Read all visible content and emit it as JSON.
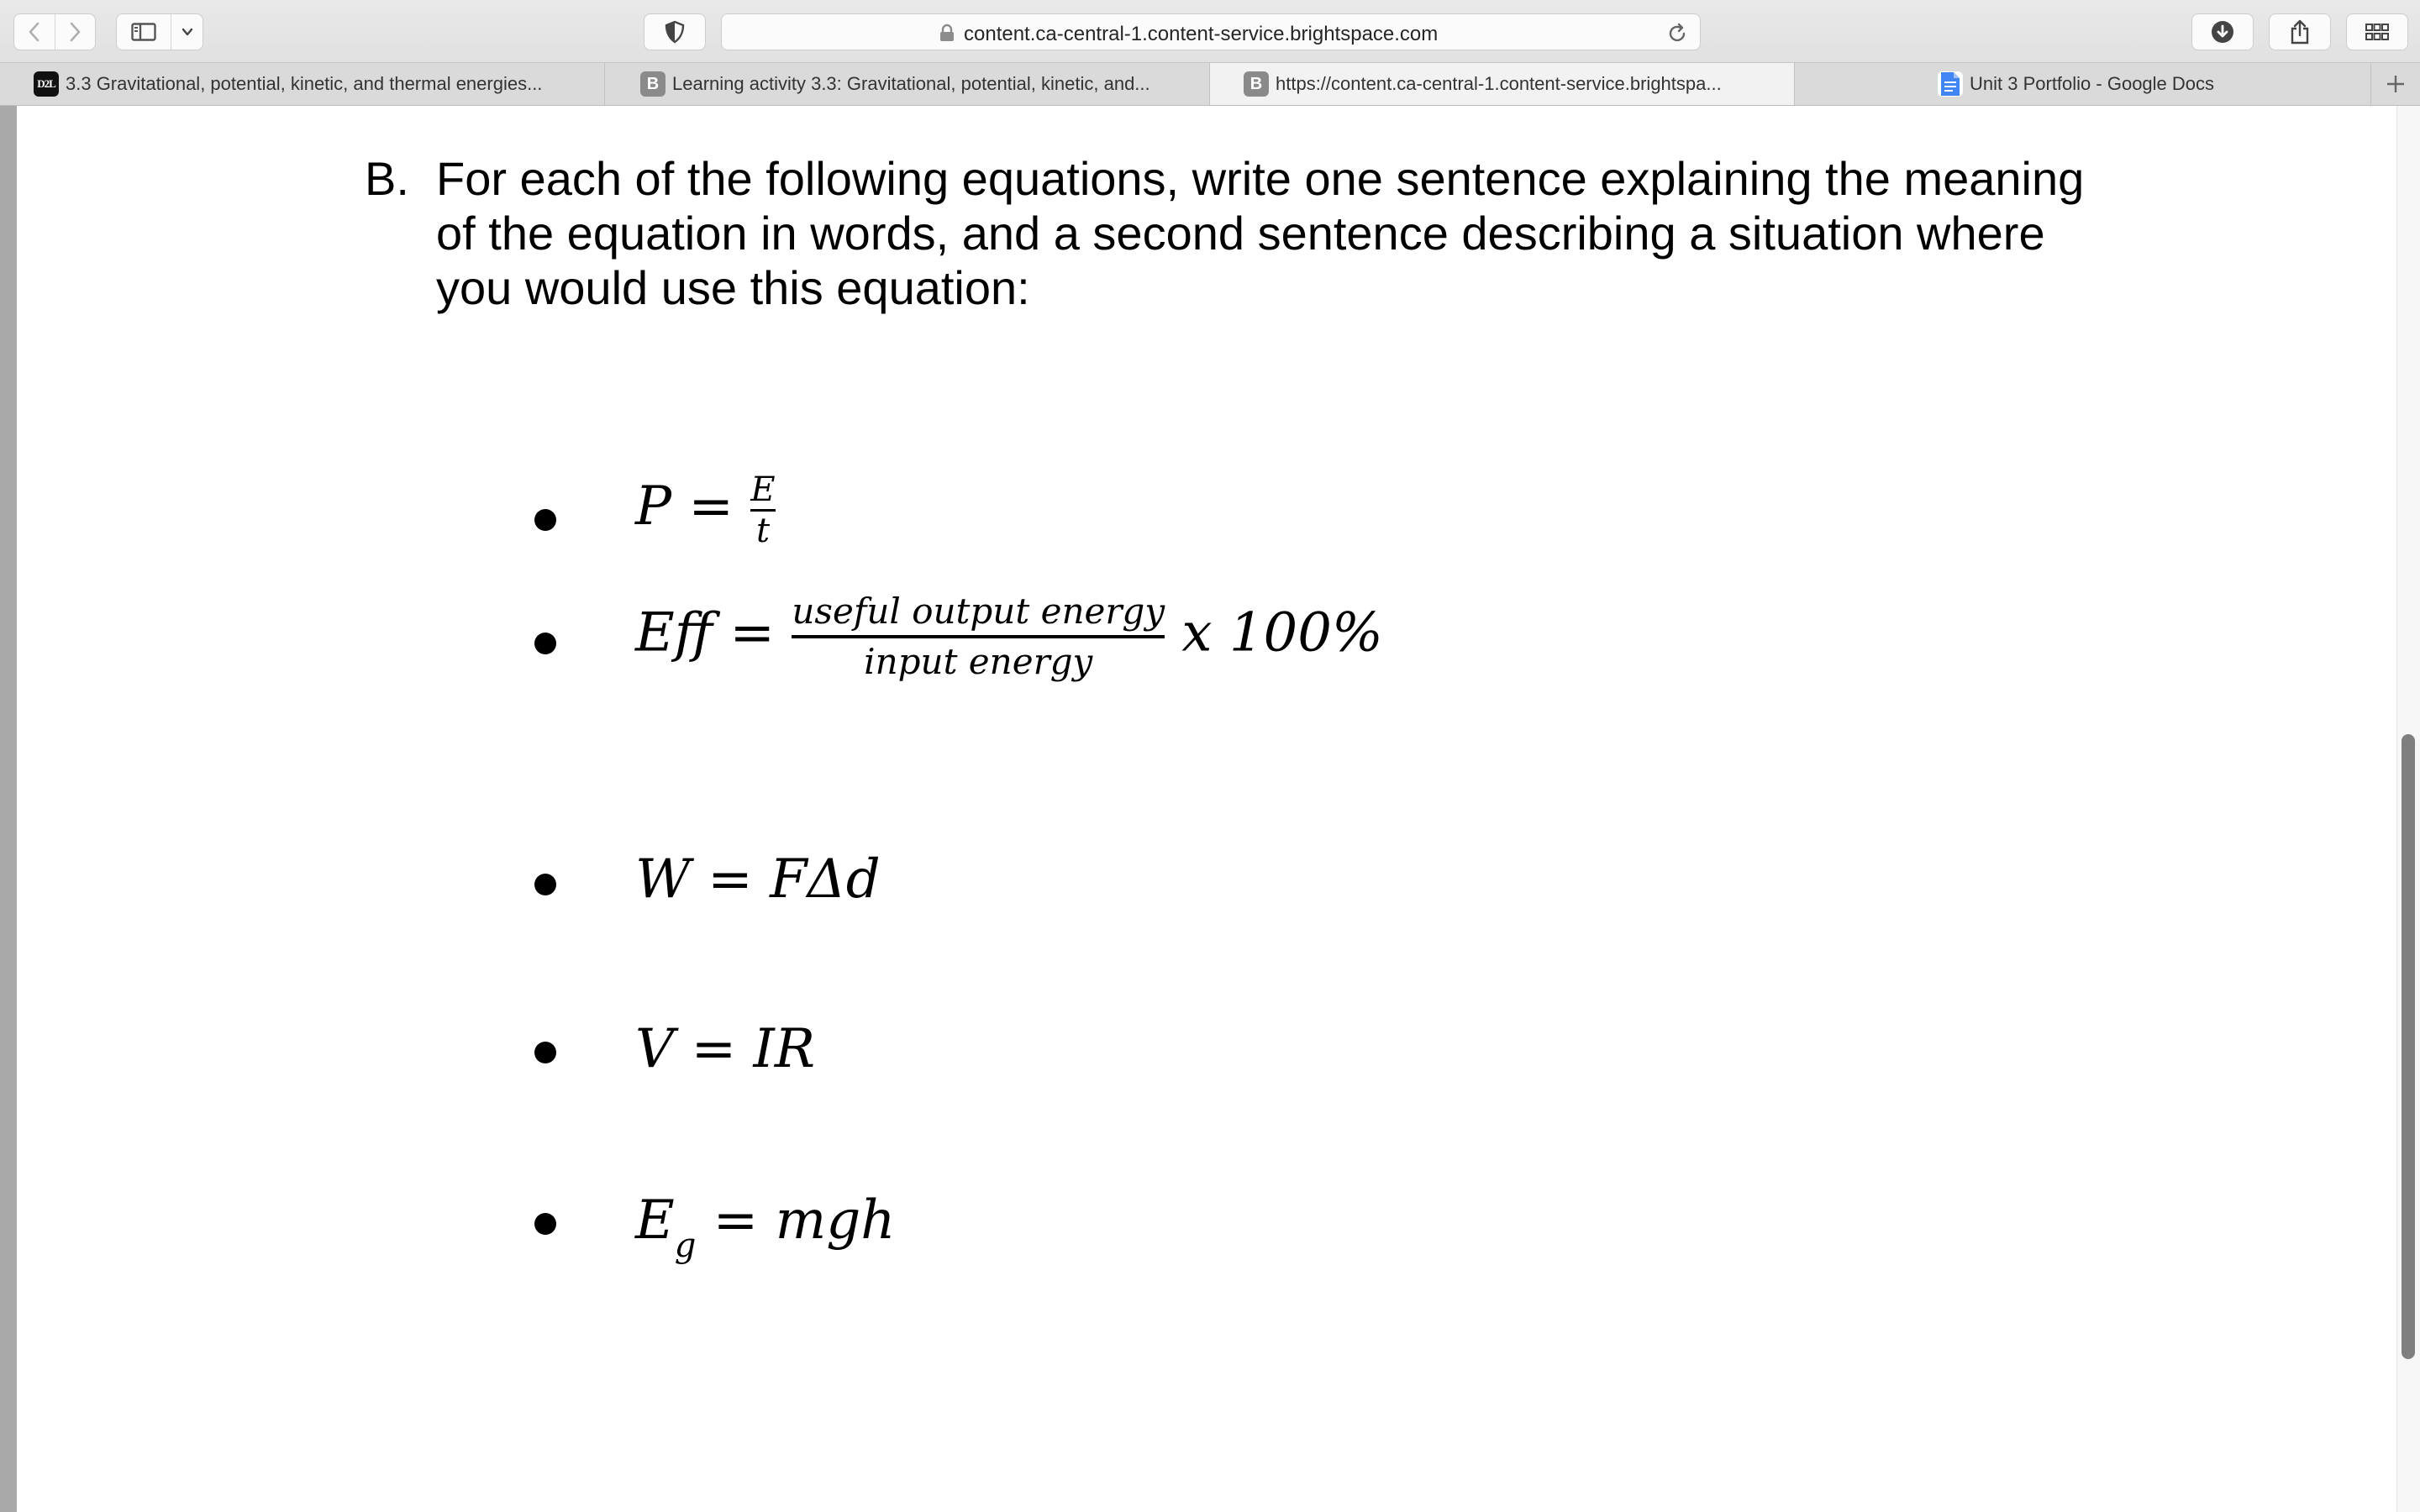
{
  "browser": {
    "url": "content.ca-central-1.content-service.brightspace.com",
    "tabs": [
      {
        "favicon": "D2L",
        "title": "3.3 Gravitational, potential, kinetic, and thermal energies..."
      },
      {
        "favicon": "B",
        "title": "Learning activity 3.3: Gravitational, potential, kinetic, and..."
      },
      {
        "favicon": "B",
        "title": "https://content.ca-central-1.content-service.brightspa..."
      },
      {
        "favicon": "google-docs-icon",
        "title": "Unit 3 Portfolio - Google Docs"
      }
    ],
    "active_tab_index": 2
  },
  "content": {
    "question_marker": "B.",
    "question_text": "For each of the following equations, write one sentence explaining the meaning of the equation in words, and a second sentence describing a situation where you would use this equation:",
    "equations": [
      {
        "lhs": "P",
        "equals": "=",
        "num": "E",
        "den": "t"
      },
      {
        "lhs": "Eff",
        "equals": "=",
        "num": "useful output energy",
        "den": "input energy",
        "suffix": "x 100%"
      },
      {
        "text": "W = FΔd"
      },
      {
        "text": "V = IR"
      },
      {
        "lhs": "E",
        "sub": "g",
        "rhs": "= mgh"
      }
    ]
  }
}
